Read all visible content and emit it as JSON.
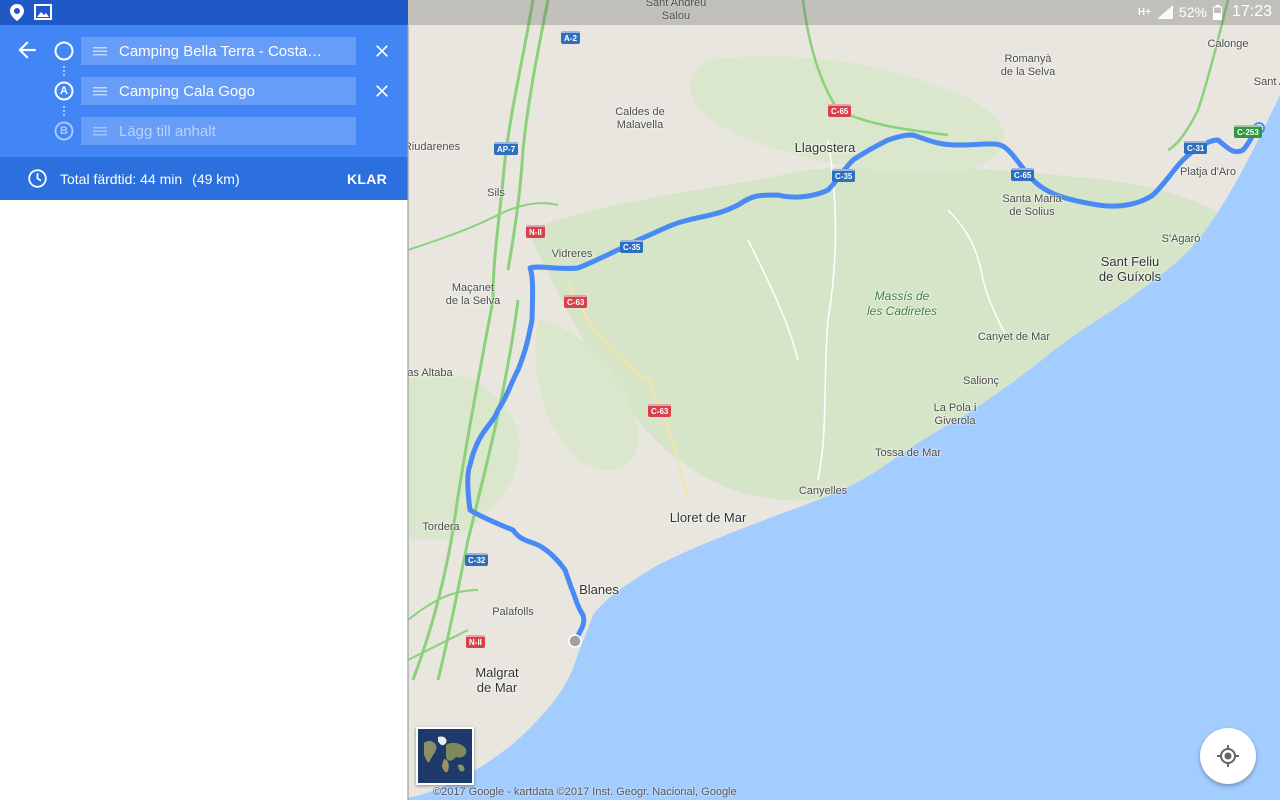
{
  "status": {
    "left_icons": [
      "location-pin-icon",
      "image-icon"
    ],
    "network": "H+",
    "battery": "52%",
    "time": "17:23"
  },
  "directions": {
    "back_icon": "arrow-back-icon",
    "origin": {
      "marker": "",
      "value": "Camping Bella Terra - Costa…"
    },
    "stop_a": {
      "marker": "A",
      "value": "Camping Cala Gogo"
    },
    "stop_b": {
      "marker": "B",
      "placeholder": "Lägg till anhalt"
    },
    "close_icon": "close-icon",
    "drag_icon": "drag-handle-icon"
  },
  "summary": {
    "label": "Total färdtid: 44 min",
    "distance": "(49 km)",
    "done": "KLAR",
    "icon": "clock-icon"
  },
  "map": {
    "places": [
      "Sant Andreu\nSalou",
      "Calonge",
      "Romanyà\nde la Selva",
      "Sant A",
      "Caldes de\nMalavella",
      "Llagostera",
      "Riudarenes",
      "Sils",
      "Vidreres",
      "Santa Maria\nde Solius",
      "Platja d'Aro",
      "S'Agaró",
      "Sant Feliu\nde Guíxols",
      "Maçanet\nde la Selva",
      "Massís de\nles Cadiretes",
      "Canyet de Mar",
      "Salionç",
      "as Altaba",
      "La Pola i\nGiverola",
      "Tossa de Mar",
      "Canyelles",
      "Lloret de Mar",
      "Tordera",
      "Blanes",
      "Palafolls",
      "Malgrat\nde Mar"
    ],
    "roads": [
      "A-2",
      "C-65",
      "AP-7",
      "C-35",
      "C-35",
      "C-65",
      "C-31",
      "C-253",
      "N-II",
      "C-35",
      "C-63",
      "C-63",
      "C-32",
      "N-II"
    ],
    "copyright": "©2017 Google - kartdata ©2017 Inst. Geogr. Nacional, Google",
    "locate_icon": "my-location-icon",
    "layer_icon": "satellite-layer-icon",
    "colors": {
      "route": "#4a8af4",
      "water": "#a3ccff",
      "land": "#e8e6df",
      "park": "#d3e5c4"
    }
  }
}
